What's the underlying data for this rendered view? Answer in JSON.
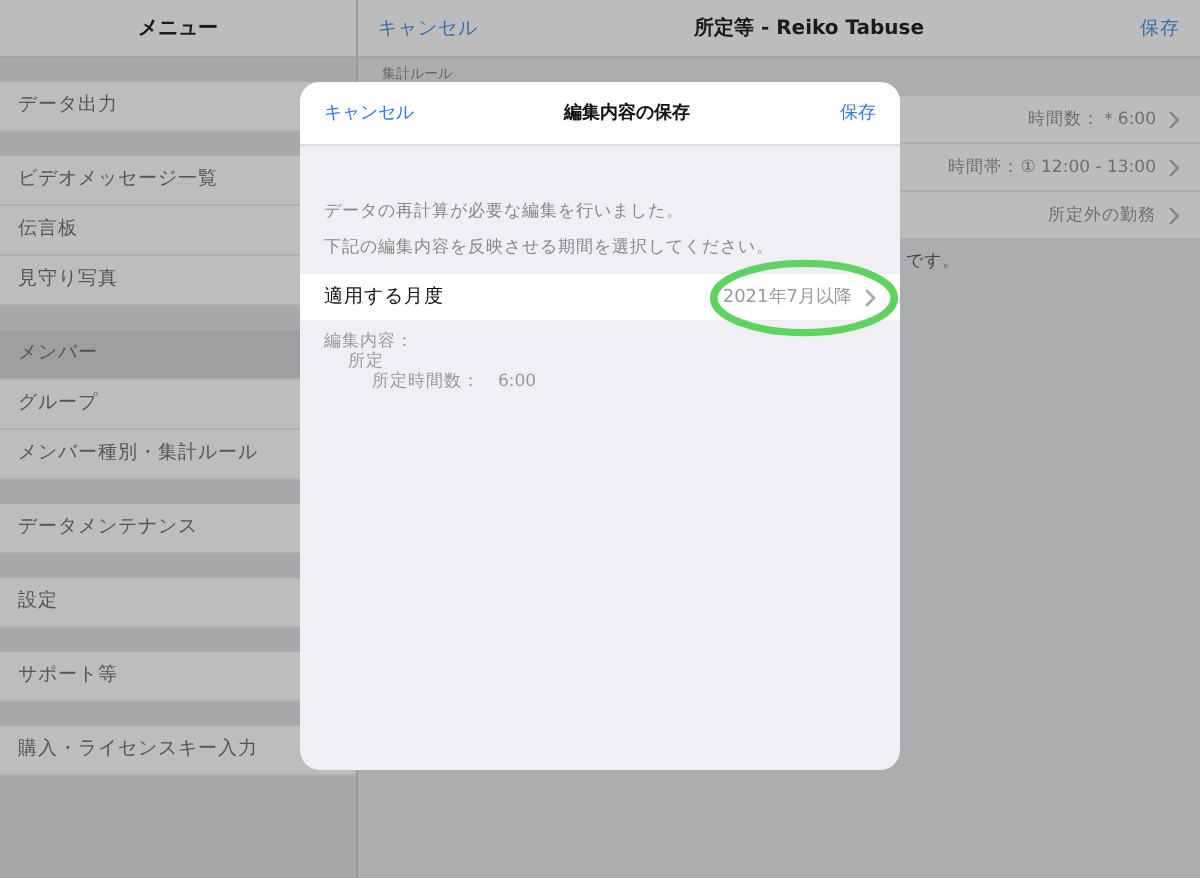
{
  "sidebar": {
    "title": "メニュー",
    "sections": [
      [
        {
          "label": "データ出力",
          "selected": false
        }
      ],
      [
        {
          "label": "ビデオメッセージ一覧",
          "selected": false
        },
        {
          "label": "伝言板",
          "selected": false
        },
        {
          "label": "見守り写真",
          "selected": false
        }
      ],
      [
        {
          "label": "メンバー",
          "selected": true
        },
        {
          "label": "グループ",
          "selected": false
        },
        {
          "label": "メンバー種別・集計ルール",
          "selected": false
        }
      ],
      [
        {
          "label": "データメンテナンス",
          "selected": false
        }
      ],
      [
        {
          "label": "設定",
          "selected": false
        }
      ],
      [
        {
          "label": "サポート等",
          "selected": false
        }
      ],
      [
        {
          "label": "購入・ライセンスキー入力",
          "selected": false
        }
      ]
    ]
  },
  "main": {
    "cancel": "キャンセル",
    "title": "所定等 - Reiko Tabuse",
    "save": "保存",
    "section_label": "集計ルール",
    "rows": [
      {
        "value": "時間数：＊6:00"
      },
      {
        "value": "時間帯：① 12:00 - 13:00"
      },
      {
        "value": "所定外の勤務"
      }
    ],
    "note_tail": "です。"
  },
  "dialog": {
    "cancel": "キャンセル",
    "title": "編集内容の保存",
    "save": "保存",
    "messages": [
      "データの再計算が必要な編集を行いました。",
      "下記の編集内容を反映させる期間を選択してください。"
    ],
    "period": {
      "label": "適用する月度",
      "value": "2021年7月以降",
      "highlighted": true
    },
    "changes": [
      "編集内容：",
      "所定",
      "所定時間数：　6:00"
    ]
  }
}
